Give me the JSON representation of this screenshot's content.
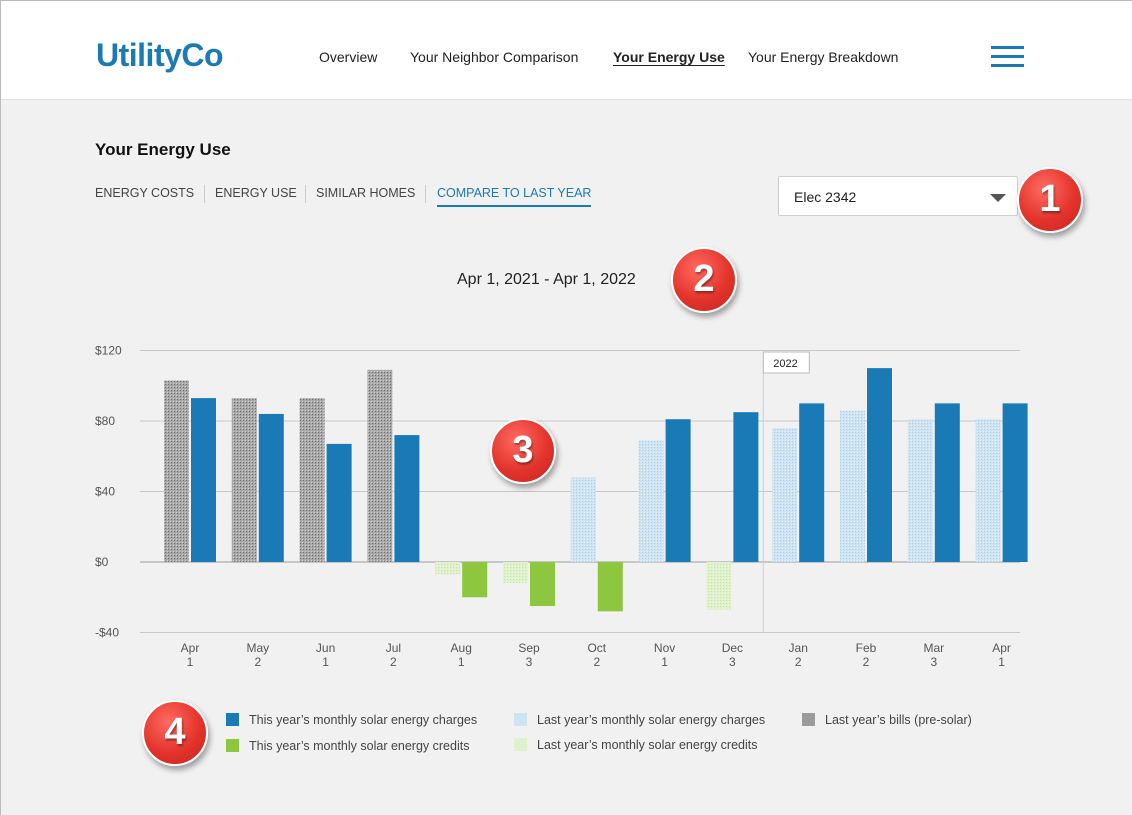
{
  "header": {
    "logo": "UtilityCo",
    "nav": [
      {
        "label": "Overview",
        "active": false
      },
      {
        "label": "Your Neighbor Comparison",
        "active": false
      },
      {
        "label": "Your Energy Use",
        "active": true
      },
      {
        "label": "Your Energy Breakdown",
        "active": false
      }
    ],
    "menu_icon": "hamburger-menu-icon"
  },
  "page": {
    "title": "Your Energy Use",
    "subtabs": [
      {
        "label": "ENERGY COSTS",
        "active": false
      },
      {
        "label": "ENERGY USE",
        "active": false
      },
      {
        "label": "SIMILAR HOMES",
        "active": false
      },
      {
        "label": "COMPARE TO LAST YEAR",
        "active": true
      }
    ],
    "account_select": {
      "value": "Elec 2342",
      "icon": "caret-down-icon"
    },
    "date_range": "Apr 1, 2021 - Apr 1, 2022"
  },
  "markers": [
    "1",
    "2",
    "3",
    "4"
  ],
  "colors": {
    "this_year_charges": "#1a7ab5",
    "this_year_credits": "#8dc63f",
    "last_year_charges": "#c9e1f1",
    "last_year_credits": "#ddefc9",
    "last_year_bills": "#9b9b9b",
    "accent": "#1a7ab5",
    "marker": "#e3342b"
  },
  "chart_data": {
    "type": "bar",
    "ylim": [
      -40,
      120
    ],
    "y_ticks": [
      "$120",
      "$80",
      "$40",
      "$0",
      "-$40"
    ],
    "y_tick_values": [
      120,
      80,
      40,
      0,
      -40
    ],
    "year_marker": {
      "label": "2022",
      "before_category_index": 9
    },
    "categories": [
      {
        "month": "Apr",
        "day": "1"
      },
      {
        "month": "May",
        "day": "2"
      },
      {
        "month": "Jun",
        "day": "1"
      },
      {
        "month": "Jul",
        "day": "2"
      },
      {
        "month": "Aug",
        "day": "1"
      },
      {
        "month": "Sep",
        "day": "3"
      },
      {
        "month": "Oct",
        "day": "2"
      },
      {
        "month": "Nov",
        "day": "1"
      },
      {
        "month": "Dec",
        "day": "3"
      },
      {
        "month": "Jan",
        "day": "2"
      },
      {
        "month": "Feb",
        "day": "2"
      },
      {
        "month": "Mar",
        "day": "3"
      },
      {
        "month": "Apr",
        "day": "1"
      }
    ],
    "series": [
      {
        "name": "Last year's bills (pre-solar)",
        "values": [
          103,
          93,
          93,
          109,
          null,
          null,
          null,
          null,
          null,
          null,
          null,
          null,
          null
        ]
      },
      {
        "name": "Last year's monthly solar energy charges",
        "values": [
          null,
          null,
          null,
          null,
          null,
          null,
          48,
          69,
          null,
          76,
          86,
          81,
          81
        ]
      },
      {
        "name": "Last year's monthly solar energy credits",
        "values": [
          null,
          null,
          null,
          null,
          -7,
          -12,
          null,
          null,
          -27,
          null,
          null,
          null,
          null
        ]
      },
      {
        "name": "This year's monthly solar energy charges",
        "values": [
          93,
          84,
          67,
          72,
          null,
          null,
          null,
          81,
          85,
          90,
          110,
          90,
          90
        ]
      },
      {
        "name": "This year's monthly solar energy credits",
        "values": [
          null,
          null,
          null,
          null,
          -20,
          -25,
          -28,
          null,
          null,
          null,
          null,
          null,
          null
        ]
      }
    ],
    "legend": [
      {
        "label": "This year’s monthly solar energy charges",
        "series": "this_year_charges"
      },
      {
        "label": "This year’s monthly solar energy credits",
        "series": "this_year_credits"
      },
      {
        "label": "Last year’s monthly solar energy charges",
        "series": "last_year_charges"
      },
      {
        "label": "Last year’s monthly solar energy credits",
        "series": "last_year_credits"
      },
      {
        "label": "Last year’s bills (pre-solar)",
        "series": "last_year_bills"
      }
    ]
  }
}
